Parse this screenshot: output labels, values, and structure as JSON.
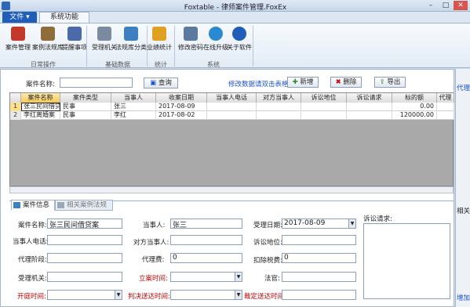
{
  "window": {
    "title": "Foxtable - 律师案件管理.FoxEx",
    "min": "–",
    "max": "□",
    "close": "✕"
  },
  "menubar": {
    "file_label": "文件 ▾",
    "tab_label": "系统功能"
  },
  "ribbon": {
    "buttons": [
      {
        "label": "案件管理",
        "color": "#c0392b"
      },
      {
        "label": "案例法规库",
        "color": "#8e6d3b"
      },
      {
        "label": "提醒事项",
        "color": "#4a6aa8"
      },
      {
        "label": "受理机关",
        "color": "#7a8aa0"
      },
      {
        "label": "法规库分类",
        "color": "#3d7fc0"
      },
      {
        "label": "业绩统计",
        "color": "#e0a020"
      },
      {
        "label": "修改密码",
        "color": "#5a7aa0"
      },
      {
        "label": "在线升级",
        "color": "#2a8ad0"
      },
      {
        "label": "关于软件",
        "color": "#1f5db8"
      }
    ],
    "groups": [
      "日常操作",
      "基础数据",
      "统计",
      "系统"
    ]
  },
  "search": {
    "label": "案件名称:",
    "value": "",
    "query_button": "查询"
  },
  "toolbar": {
    "hint": "修改数据请双击表格",
    "new_button": "新增",
    "delete_button": "删除",
    "export_button": "导出"
  },
  "table": {
    "columns": [
      "案件名称",
      "案件类型",
      "当事人",
      "收案日期",
      "当事人电话",
      "对方当事人",
      "诉讼地位",
      "诉讼请求",
      "标的额",
      "代理"
    ],
    "rows": [
      {
        "num": "1",
        "cells": [
          "张三民间借贷案",
          "民事",
          "张三",
          "2017-08-09",
          "",
          "",
          "",
          "",
          "0.00",
          ""
        ]
      },
      {
        "num": "2",
        "cells": [
          "李红离婚案",
          "民事",
          "李红",
          "2017-08-02",
          "",
          "",
          "",
          "",
          "120000.00",
          ""
        ]
      }
    ]
  },
  "tabs": {
    "case_info": "案件信息",
    "related": "相关案例法规"
  },
  "form": {
    "case_name_label": "案件名称:",
    "case_name_value": "张三民间借贷案",
    "party_label": "当事人:",
    "party_value": "张三",
    "accept_date_label": "受理日期:",
    "accept_date_value": "2017-08-09",
    "claim_label": "诉讼请求:",
    "party_phone_label": "当事人电话:",
    "party_phone_value": "",
    "opponent_label": "对方当事人:",
    "opponent_value": "",
    "status_label": "诉讼地位:",
    "status_value": "",
    "stage_label": "代理阶段:",
    "stage_value": "",
    "fee_label": "代理费:",
    "fee_value": "0",
    "tax_label": "扣除税费:",
    "tax_value": "0",
    "agency_label": "受理机关:",
    "agency_value": "",
    "filing_time_label": "立案时间:",
    "filing_time_value": "",
    "judge_label": "法官:",
    "judge_value": "",
    "hearing_label": "开庭时间:",
    "hearing_value": "",
    "judgment_label": "判决送达时间:",
    "judgment_value": "",
    "ruling_label": "裁定送达时间:",
    "ruling_value": ""
  },
  "right": {
    "label1": "代理",
    "label2": "相关文",
    "link": "增加"
  }
}
